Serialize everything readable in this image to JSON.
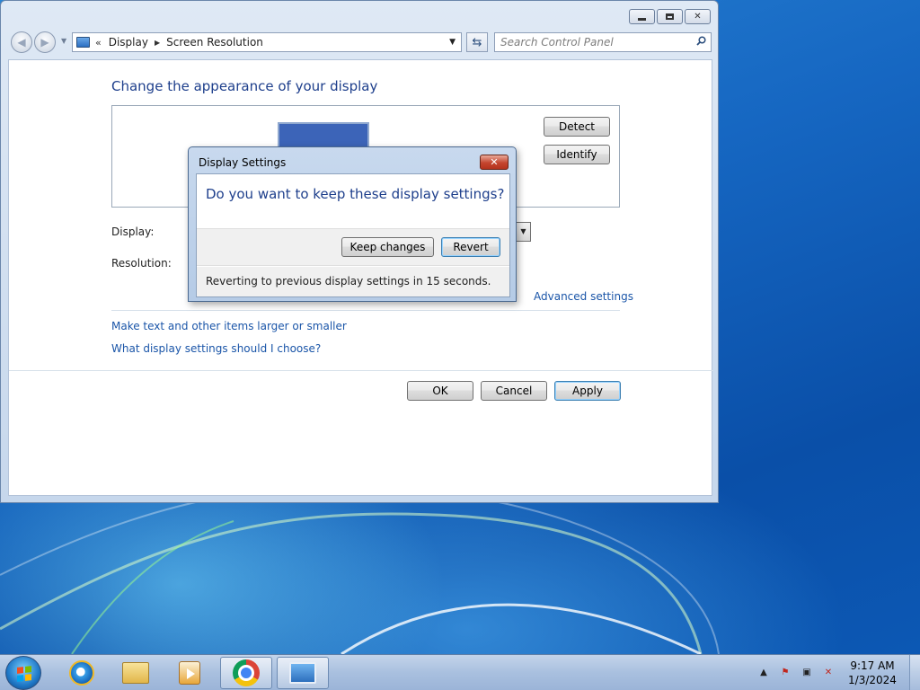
{
  "window": {
    "caption_min": "",
    "caption_max": "",
    "caption_close": "✕"
  },
  "address": {
    "chevron": "«",
    "crumbs": [
      "Display",
      "Screen Resolution"
    ],
    "search_placeholder": "Search Control Panel"
  },
  "page": {
    "title": "Change the appearance of your display",
    "detect_label": "Detect",
    "identify_label": "Identify",
    "display_label": "Display:",
    "resolution_label": "Resolution:",
    "advanced_link": "Advanced settings",
    "larger_link": "Make text and other items larger or smaller",
    "which_link": "What display settings should I choose?",
    "ok_label": "OK",
    "cancel_label": "Cancel",
    "apply_label": "Apply"
  },
  "dialog": {
    "title": "Display Settings",
    "close": "✕",
    "question": "Do you want to keep these display settings?",
    "keep_label": "Keep changes",
    "revert_label": "Revert",
    "status": "Reverting to previous display settings in 15 seconds."
  },
  "taskbar": {
    "items": [
      {
        "name": "internet-explorer-icon"
      },
      {
        "name": "windows-explorer-icon"
      },
      {
        "name": "media-player-icon"
      },
      {
        "name": "chrome-icon"
      },
      {
        "name": "control-panel-icon"
      }
    ],
    "tray_up": "▲",
    "clock_time": "9:17 AM",
    "clock_date": "1/3/2024"
  },
  "colors": {
    "link": "#1a55a8",
    "heading": "#1e3f8c",
    "close_red": "#c4452e"
  }
}
